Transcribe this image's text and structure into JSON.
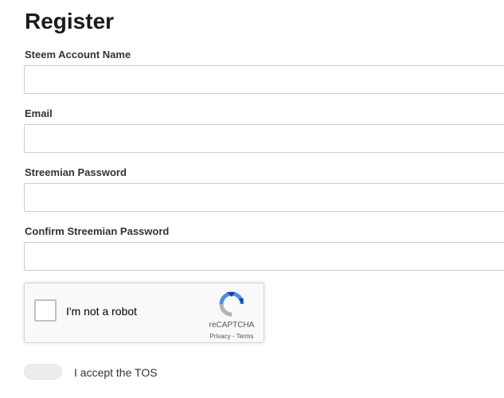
{
  "page": {
    "title": "Register"
  },
  "form": {
    "fields": [
      {
        "label": "Steem Account Name",
        "value": "",
        "placeholder": ""
      },
      {
        "label": "Email",
        "value": "",
        "placeholder": ""
      },
      {
        "label": "Streemian Password",
        "value": "",
        "placeholder": ""
      },
      {
        "label": "Confirm Streemian Password",
        "value": "",
        "placeholder": ""
      }
    ]
  },
  "captcha": {
    "label": "I'm not a robot",
    "brand": "reCAPTCHA",
    "privacy_link": "Privacy",
    "separator": " - ",
    "terms_link": "Terms",
    "checked": false,
    "logo_colors": {
      "blue": "#4a90e2",
      "dark_blue": "#1c3aa9",
      "grey": "#b3b3b3"
    }
  },
  "tos": {
    "label": "I accept the TOS",
    "accepted": false
  },
  "colors": {
    "input_border": "#cccccc",
    "toggle_track": "#ececec"
  }
}
